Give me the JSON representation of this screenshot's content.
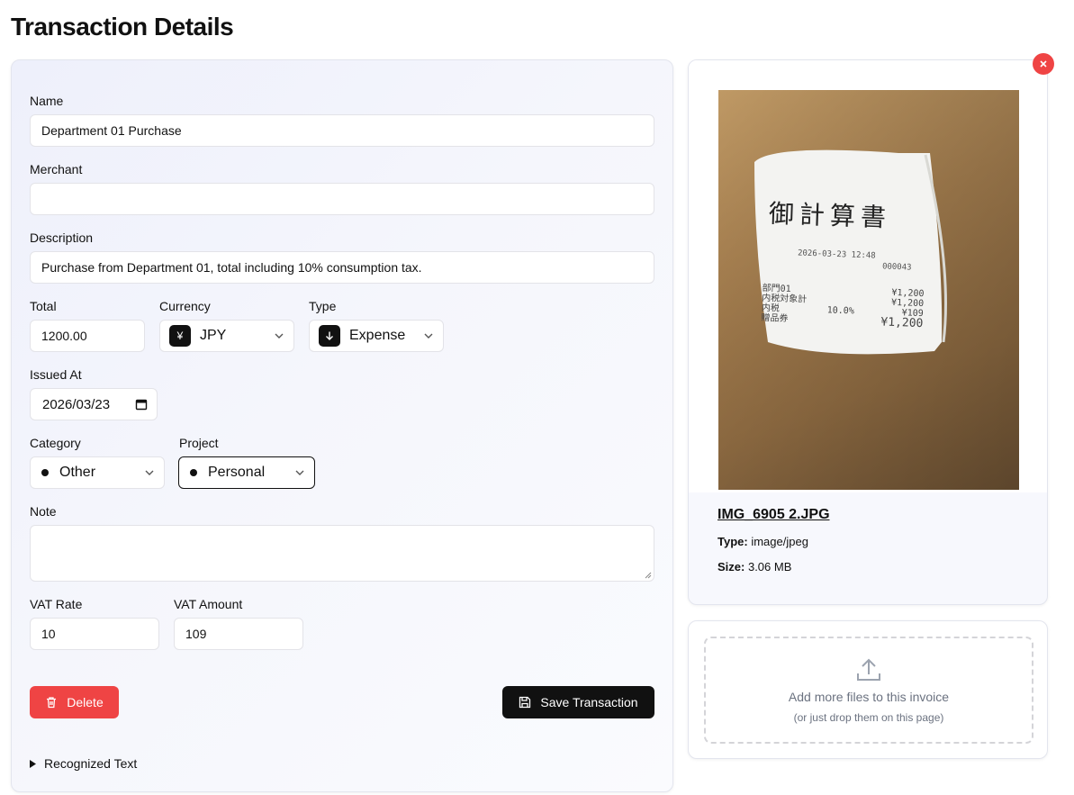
{
  "page": {
    "title": "Transaction Details"
  },
  "form": {
    "name_label": "Name",
    "name_value": "Department 01 Purchase",
    "merchant_label": "Merchant",
    "merchant_value": "",
    "description_label": "Description",
    "description_value": "Purchase from Department 01, total including 10% consumption tax.",
    "total_label": "Total",
    "total_value": "1200.00",
    "currency_label": "Currency",
    "currency_symbol": "¥",
    "currency_value": "JPY",
    "type_label": "Type",
    "type_value": "Expense",
    "issued_label": "Issued At",
    "issued_value": "2026/03/23",
    "category_label": "Category",
    "category_value": "Other",
    "project_label": "Project",
    "project_value": "Personal",
    "note_label": "Note",
    "note_value": "",
    "vat_rate_label": "VAT Rate",
    "vat_rate_value": "10",
    "vat_amount_label": "VAT Amount",
    "vat_amount_value": "109",
    "delete_label": "Delete",
    "save_label": "Save Transaction",
    "recognized_label": "Recognized Text"
  },
  "file": {
    "name": "IMG_6905 2.JPG",
    "type_label": "Type:",
    "type_value": "image/jpeg",
    "size_label": "Size:",
    "size_value": "3.06 MB"
  },
  "receipt": {
    "title": "御計算書",
    "datetime": "2026-03-23 12:48",
    "number": "000043",
    "line1_left": "部門01",
    "line1_right": "¥1,200",
    "line2_left": "内税対象計",
    "line2_right": "¥1,200",
    "line3_left": "内税",
    "line3_mid": "10.0%",
    "line3_right": "¥109",
    "line4_left": "贈品券",
    "line4_right": "¥1,200"
  },
  "upload": {
    "title": "Add more files to this invoice",
    "subtitle": "(or just drop them on this page)"
  },
  "icons": {
    "close": "close-icon",
    "trash": "trash-icon",
    "save": "save-icon",
    "upload": "upload-icon",
    "calendar": "calendar-icon",
    "chevron": "chevron-down-icon",
    "caret": "triangle-right-icon",
    "expense": "arrow-down-icon"
  },
  "colors": {
    "danger": "#ef4444",
    "primary": "#111111",
    "card_bg": "#eef0fb"
  }
}
